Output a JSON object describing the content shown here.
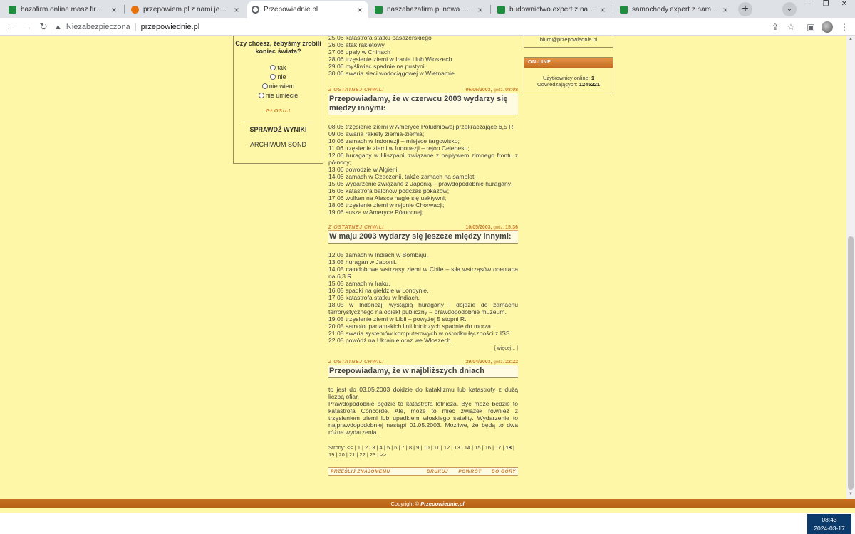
{
  "browser": {
    "tabs": [
      {
        "title": "bazafirm.online masz firmę kup w...",
        "favicon_color": "#1e8e3e",
        "active": false
      },
      {
        "title": "przepowiem.pl z nami jesteś znan...",
        "favicon_color": "#e8710a",
        "active": false
      },
      {
        "title": "Przepowiednie.pl",
        "favicon_color": "#5f6368",
        "active": true
      },
      {
        "title": "naszabazafirm.pl nowa wyszukiwa...",
        "favicon_color": "#1e8e3e",
        "active": false
      },
      {
        "title": "budownictwo.expert z nami jesteś...",
        "favicon_color": "#1e8e3e",
        "active": false
      },
      {
        "title": "samochody.expert z nami jesteś z...",
        "favicon_color": "#1e8e3e",
        "active": false
      }
    ],
    "close_glyph": "×",
    "new_tab_glyph": "+",
    "address": {
      "security_label": "Niezabezpieczona",
      "separator": "|",
      "url": "przepowiednie.pl"
    }
  },
  "poll": {
    "question": "Czy chcesz, żebyśmy zrobili koniec świata?",
    "options": [
      "tak",
      "nie",
      "nie wiem",
      "nie umiecie"
    ],
    "vote_label": "GŁOSUJ",
    "results_label": "SPRAWDŹ WYNIKI",
    "archive_label": "ARCHIWUM SOND"
  },
  "top_lines": [
    "25.06 katastrofa statku pasażerskiego",
    "26.06 atak rakietowy",
    "27.06 upały w Chinach",
    "28.06 trzęsienie ziemi w Iranie i lub Włoszech",
    "29.06 myśliwiec spadnie na pustyni",
    "30.06 awaria sieci wodociągowej w Wietnamie"
  ],
  "news": [
    {
      "category": "Z OSTATNEJ CHWILI",
      "date": "06/06/2003,",
      "godz_label": "godz.",
      "time": "08:08",
      "title": "Przepowiadamy, że w czerwcu 2003 wydarzy się między innymi:",
      "lines": [
        "08.06 trzęsienie ziemi w Ameryce Południowej przekraczające 6,5 R;",
        "09.06 awaria rakiety ziemia-ziemia;",
        "10.06 zamach w Indonezji – miejsce targowisko;",
        "11.06 trzęsienie ziemi w Indonezji – rejon Celebesu;",
        "12.06 huragany w Hiszpanii związane z napływem zimnego frontu z północy;",
        "13.06 powodzie w Algierii;",
        "14.06 zamach w Czeczenii, także zamach na samolot;",
        "15.06 wydarzenie związane z Japonią – prawdopodobnie huragany;",
        "16.06 katastrofa balonów podczas pokazów;",
        "17.06 wulkan na Alasce nagle się uaktywni;",
        "18.06 trzęsienie ziemi w rejonie Chorwacji;",
        "19.06 susza w Ameryce Północnej;"
      ]
    },
    {
      "category": "Z OSTATNEJ CHWILI",
      "date": "10/05/2003,",
      "godz_label": "godz.",
      "time": "15:36",
      "title": "W maju 2003 wydarzy się jeszcze między innymi:",
      "lines": [
        "12.05 zamach w Indiach w Bombaju.",
        "13.05 huragan w Japonii.",
        "14.05 całodobowe wstrząsy ziemi w Chile – siła wstrząsów oceniana na 6,3 R.",
        "15.05 zamach w Iraku.",
        "16.05 spadki na giełdzie w Londynie.",
        "17.05 katastrofa statku w Indiach.",
        "18.05 w Indonezji wystąpią huragany i dojdzie do zamachu terrorystycznego na obiekt publiczny – prawdopodobnie muzeum.",
        "19.05 trzęsienie ziemi w Libii – powyżej 5 stopni R.",
        "20.05 samolot panamskich linii lotniczych spadnie do morza.",
        "21.05 awaria systemów komputerowych w ośrodku łączności z ISS.",
        "22.05 powódź na Ukrainie oraz we Włoszech."
      ],
      "more_label": "[ więcej... ]"
    },
    {
      "category": "Z OSTATNEJ CHWILI",
      "date": "29/04/2003,",
      "godz_label": "godz.",
      "time": "22:22",
      "title": "Przepowiadamy, że w najbliższych dniach",
      "lines": [
        "to jest do 03.05.2003 dojdzie do kataklizmu lub katastrofy z dużą liczbą ofiar.",
        "Prawdopodobnie będzie to katastrofa lotnicza. Być może będzie to katastrofa Concorde. Ale, może to mieć związek również z trzęsieniem ziemi lub upadkiem włoskiego satelity. Wydarzenie to najprawdopodobniej nastąpi 01.05.2003. Możliwe, że będą to dwa różne wydarzenia."
      ]
    }
  ],
  "pager": {
    "label": "Strony:",
    "prev": "<<",
    "pages": [
      "1",
      "2",
      "3",
      "4",
      "5",
      "6",
      "7",
      "8",
      "9",
      "10",
      "11",
      "12",
      "13",
      "14",
      "15",
      "16",
      "17",
      "18",
      "19",
      "20",
      "21",
      "22",
      "23"
    ],
    "current": "18",
    "next": ">>"
  },
  "footer_links": {
    "send": "PRZEŚLIJ ZNAJOMEMU",
    "print": "DRUKUJ",
    "back": "POWRÓT",
    "top": "DO GÓRY"
  },
  "contact": {
    "email": "biuro@przepowiednie.pl"
  },
  "online": {
    "header": "ON-LINE",
    "users_label": "Użytkownicy online:",
    "users_value": "1",
    "visits_label": "Odwiedzających:",
    "visits_value": "1245221"
  },
  "copyright": {
    "prefix": "Copyright ©",
    "brand": "Przepowiednie.pl"
  },
  "taskbar": {
    "time": "08:43",
    "date": "2024-03-17"
  },
  "colors": {
    "page_bg": "#fff7a8",
    "accent_orange": "#c77a2a",
    "header_orange": "#d07828"
  }
}
